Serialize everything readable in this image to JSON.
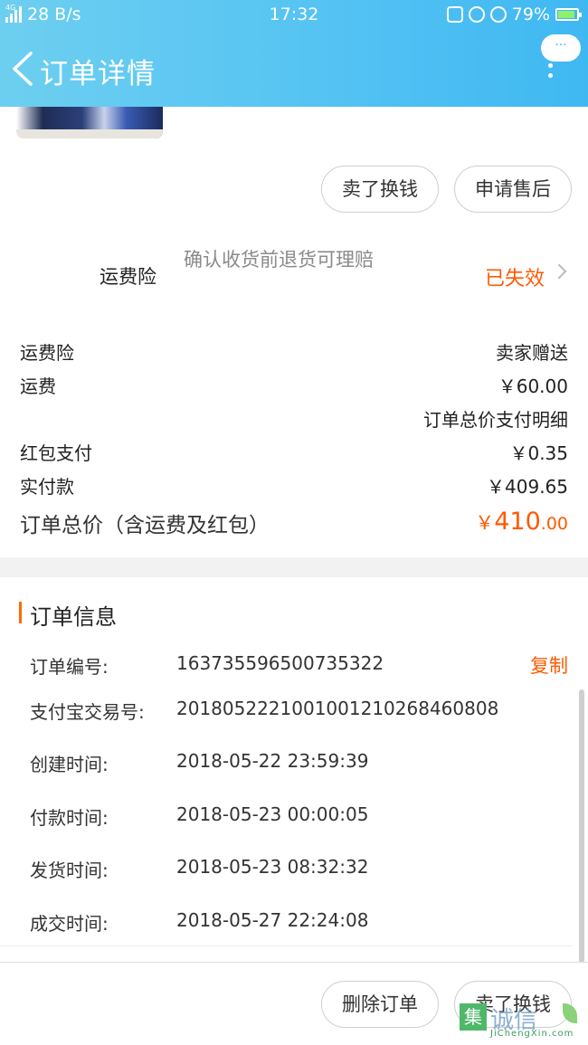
{
  "status_bar": {
    "network_tag": "4G",
    "speed": "28 B/s",
    "time": "17:32",
    "battery": "79%"
  },
  "header": {
    "title": "订单详情",
    "more_label": "···"
  },
  "actions_top": {
    "sell_label": "卖了换钱",
    "after_sale_label": "申请售后"
  },
  "insurance": {
    "label": "运费险",
    "description": "确认收货前退货可理赔",
    "status": "已失效"
  },
  "fees": [
    {
      "label": "运费险",
      "value": "卖家赠送"
    },
    {
      "label": "运费",
      "value": "￥60.00"
    },
    {
      "label": "",
      "value": "订单总价支付明细"
    },
    {
      "label": "红包支付",
      "value": "￥0.35"
    },
    {
      "label": "实付款",
      "value": "￥409.65"
    }
  ],
  "total": {
    "label": "订单总价（含运费及红包）",
    "currency": "￥",
    "integer": "410",
    "decimal": ".00"
  },
  "order_info": {
    "title": "订单信息",
    "copy_label": "复制",
    "rows": [
      {
        "label": "订单编号:",
        "value": "163735596500735322"
      },
      {
        "label": "支付宝交易号:",
        "value": "2018052221001001210268460808"
      },
      {
        "label": "创建时间:",
        "value": "2018-05-22 23:59:39"
      },
      {
        "label": "付款时间:",
        "value": "2018-05-23 00:00:05"
      },
      {
        "label": "发货时间:",
        "value": "2018-05-23 08:32:32"
      },
      {
        "label": "成交时间:",
        "value": "2018-05-27 22:24:08"
      }
    ]
  },
  "actions_bottom": {
    "delete_label": "删除订单",
    "sell_label": "卖了换钱"
  },
  "watermark": {
    "glyph": "集",
    "text": "诚信",
    "sub": "JiChengXin.com"
  },
  "colors": {
    "header_gradient_start": "#6dcff0",
    "header_gradient_end": "#3fb8f2",
    "accent_orange": "#ff5a00",
    "section_gap": "#f2f2f2"
  }
}
